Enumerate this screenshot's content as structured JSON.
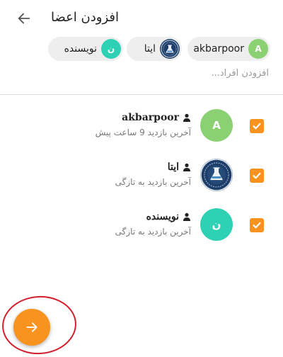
{
  "header": {
    "title": "افزودن اعضا",
    "back_icon": "arrow-left-icon"
  },
  "selected_chips": [
    {
      "label": "akbarpoor",
      "avatar_letter": "A",
      "avatar_color": "#8bd174"
    },
    {
      "label": "ایتا",
      "avatar_type": "logo",
      "avatar_color": "#1f3f6a"
    },
    {
      "label": "نویسنده",
      "avatar_letter": "ن",
      "avatar_color": "#2fd1b5"
    }
  ],
  "search": {
    "placeholder": "افزودن افراد..."
  },
  "members": [
    {
      "name": "akbarpoor",
      "status": "آخرین بازدید 9 ساعت پیش",
      "avatar_letter": "A",
      "avatar_color": "#8bd174",
      "checked": true
    },
    {
      "name": "ایتا",
      "status": "آخرین بازدید به تازگی",
      "avatar_type": "logo",
      "avatar_color": "#1f3f6a",
      "checked": true
    },
    {
      "name": "نویسنده",
      "status": "آخرین بازدید به تازگی",
      "avatar_letter": "ن",
      "avatar_color": "#2fd1b5",
      "checked": true
    }
  ],
  "fab": {
    "icon": "arrow-right-icon",
    "color": "#f7931e"
  },
  "annotation": {
    "color": "#d2202f"
  }
}
